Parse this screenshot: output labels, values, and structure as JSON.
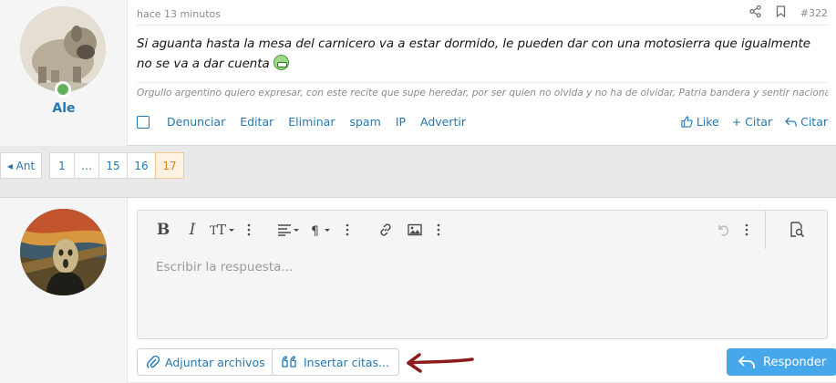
{
  "post": {
    "username": "Ale",
    "timestamp": "hace 13 minutos",
    "post_number": "#322",
    "message": "Si aguanta hasta la mesa del carnicero va a estar dormido, le pueden dar con una motosierra que igualmente no se va a dar cuenta",
    "signature": "Orgullo argentino quiero expresar, con este recite que supe heredar, por ser quien no olvida y no ha de olvidar, Patria bandera y sentir nacional...",
    "actions": [
      "Denunciar",
      "Editar",
      "Eliminar",
      "spam",
      "IP",
      "Advertir"
    ],
    "like_label": "Like",
    "quote_label": "+ Citar",
    "reply_label": "Citar"
  },
  "pagination": {
    "prev_label": "◂ Ant",
    "pages": [
      "1",
      "…",
      "15",
      "16",
      "17"
    ],
    "current": "17"
  },
  "editor": {
    "placeholder": "Escribir la respuesta...",
    "attach_label": "Adjuntar archivos",
    "insert_quotes_label": "Insertar citas...",
    "submit_label": "Responder"
  },
  "colors": {
    "link": "#2577b1",
    "primary": "#47a7eb",
    "online": "#63b15b",
    "arrow": "#8b1a1a"
  }
}
